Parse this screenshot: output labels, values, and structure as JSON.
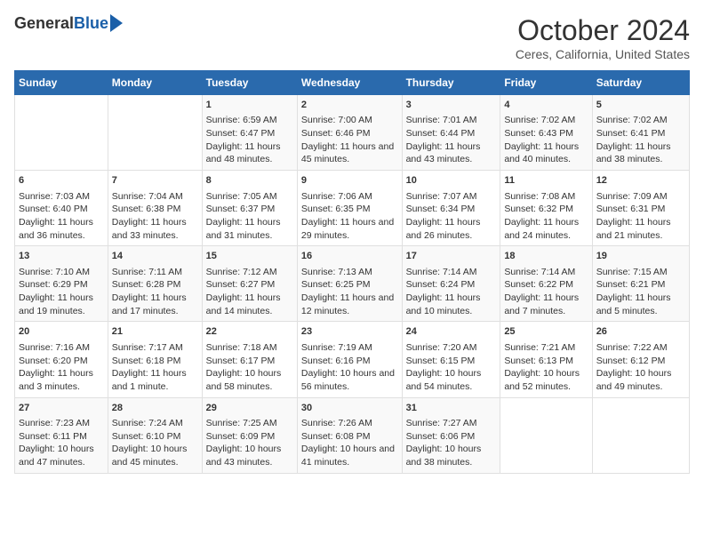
{
  "header": {
    "logo_general": "General",
    "logo_blue": "Blue",
    "month_title": "October 2024",
    "location": "Ceres, California, United States"
  },
  "columns": [
    "Sunday",
    "Monday",
    "Tuesday",
    "Wednesday",
    "Thursday",
    "Friday",
    "Saturday"
  ],
  "weeks": [
    [
      {
        "day": "",
        "sunrise": "",
        "sunset": "",
        "daylight": ""
      },
      {
        "day": "",
        "sunrise": "",
        "sunset": "",
        "daylight": ""
      },
      {
        "day": "1",
        "sunrise": "Sunrise: 6:59 AM",
        "sunset": "Sunset: 6:47 PM",
        "daylight": "Daylight: 11 hours and 48 minutes."
      },
      {
        "day": "2",
        "sunrise": "Sunrise: 7:00 AM",
        "sunset": "Sunset: 6:46 PM",
        "daylight": "Daylight: 11 hours and 45 minutes."
      },
      {
        "day": "3",
        "sunrise": "Sunrise: 7:01 AM",
        "sunset": "Sunset: 6:44 PM",
        "daylight": "Daylight: 11 hours and 43 minutes."
      },
      {
        "day": "4",
        "sunrise": "Sunrise: 7:02 AM",
        "sunset": "Sunset: 6:43 PM",
        "daylight": "Daylight: 11 hours and 40 minutes."
      },
      {
        "day": "5",
        "sunrise": "Sunrise: 7:02 AM",
        "sunset": "Sunset: 6:41 PM",
        "daylight": "Daylight: 11 hours and 38 minutes."
      }
    ],
    [
      {
        "day": "6",
        "sunrise": "Sunrise: 7:03 AM",
        "sunset": "Sunset: 6:40 PM",
        "daylight": "Daylight: 11 hours and 36 minutes."
      },
      {
        "day": "7",
        "sunrise": "Sunrise: 7:04 AM",
        "sunset": "Sunset: 6:38 PM",
        "daylight": "Daylight: 11 hours and 33 minutes."
      },
      {
        "day": "8",
        "sunrise": "Sunrise: 7:05 AM",
        "sunset": "Sunset: 6:37 PM",
        "daylight": "Daylight: 11 hours and 31 minutes."
      },
      {
        "day": "9",
        "sunrise": "Sunrise: 7:06 AM",
        "sunset": "Sunset: 6:35 PM",
        "daylight": "Daylight: 11 hours and 29 minutes."
      },
      {
        "day": "10",
        "sunrise": "Sunrise: 7:07 AM",
        "sunset": "Sunset: 6:34 PM",
        "daylight": "Daylight: 11 hours and 26 minutes."
      },
      {
        "day": "11",
        "sunrise": "Sunrise: 7:08 AM",
        "sunset": "Sunset: 6:32 PM",
        "daylight": "Daylight: 11 hours and 24 minutes."
      },
      {
        "day": "12",
        "sunrise": "Sunrise: 7:09 AM",
        "sunset": "Sunset: 6:31 PM",
        "daylight": "Daylight: 11 hours and 21 minutes."
      }
    ],
    [
      {
        "day": "13",
        "sunrise": "Sunrise: 7:10 AM",
        "sunset": "Sunset: 6:29 PM",
        "daylight": "Daylight: 11 hours and 19 minutes."
      },
      {
        "day": "14",
        "sunrise": "Sunrise: 7:11 AM",
        "sunset": "Sunset: 6:28 PM",
        "daylight": "Daylight: 11 hours and 17 minutes."
      },
      {
        "day": "15",
        "sunrise": "Sunrise: 7:12 AM",
        "sunset": "Sunset: 6:27 PM",
        "daylight": "Daylight: 11 hours and 14 minutes."
      },
      {
        "day": "16",
        "sunrise": "Sunrise: 7:13 AM",
        "sunset": "Sunset: 6:25 PM",
        "daylight": "Daylight: 11 hours and 12 minutes."
      },
      {
        "day": "17",
        "sunrise": "Sunrise: 7:14 AM",
        "sunset": "Sunset: 6:24 PM",
        "daylight": "Daylight: 11 hours and 10 minutes."
      },
      {
        "day": "18",
        "sunrise": "Sunrise: 7:14 AM",
        "sunset": "Sunset: 6:22 PM",
        "daylight": "Daylight: 11 hours and 7 minutes."
      },
      {
        "day": "19",
        "sunrise": "Sunrise: 7:15 AM",
        "sunset": "Sunset: 6:21 PM",
        "daylight": "Daylight: 11 hours and 5 minutes."
      }
    ],
    [
      {
        "day": "20",
        "sunrise": "Sunrise: 7:16 AM",
        "sunset": "Sunset: 6:20 PM",
        "daylight": "Daylight: 11 hours and 3 minutes."
      },
      {
        "day": "21",
        "sunrise": "Sunrise: 7:17 AM",
        "sunset": "Sunset: 6:18 PM",
        "daylight": "Daylight: 11 hours and 1 minute."
      },
      {
        "day": "22",
        "sunrise": "Sunrise: 7:18 AM",
        "sunset": "Sunset: 6:17 PM",
        "daylight": "Daylight: 10 hours and 58 minutes."
      },
      {
        "day": "23",
        "sunrise": "Sunrise: 7:19 AM",
        "sunset": "Sunset: 6:16 PM",
        "daylight": "Daylight: 10 hours and 56 minutes."
      },
      {
        "day": "24",
        "sunrise": "Sunrise: 7:20 AM",
        "sunset": "Sunset: 6:15 PM",
        "daylight": "Daylight: 10 hours and 54 minutes."
      },
      {
        "day": "25",
        "sunrise": "Sunrise: 7:21 AM",
        "sunset": "Sunset: 6:13 PM",
        "daylight": "Daylight: 10 hours and 52 minutes."
      },
      {
        "day": "26",
        "sunrise": "Sunrise: 7:22 AM",
        "sunset": "Sunset: 6:12 PM",
        "daylight": "Daylight: 10 hours and 49 minutes."
      }
    ],
    [
      {
        "day": "27",
        "sunrise": "Sunrise: 7:23 AM",
        "sunset": "Sunset: 6:11 PM",
        "daylight": "Daylight: 10 hours and 47 minutes."
      },
      {
        "day": "28",
        "sunrise": "Sunrise: 7:24 AM",
        "sunset": "Sunset: 6:10 PM",
        "daylight": "Daylight: 10 hours and 45 minutes."
      },
      {
        "day": "29",
        "sunrise": "Sunrise: 7:25 AM",
        "sunset": "Sunset: 6:09 PM",
        "daylight": "Daylight: 10 hours and 43 minutes."
      },
      {
        "day": "30",
        "sunrise": "Sunrise: 7:26 AM",
        "sunset": "Sunset: 6:08 PM",
        "daylight": "Daylight: 10 hours and 41 minutes."
      },
      {
        "day": "31",
        "sunrise": "Sunrise: 7:27 AM",
        "sunset": "Sunset: 6:06 PM",
        "daylight": "Daylight: 10 hours and 38 minutes."
      },
      {
        "day": "",
        "sunrise": "",
        "sunset": "",
        "daylight": ""
      },
      {
        "day": "",
        "sunrise": "",
        "sunset": "",
        "daylight": ""
      }
    ]
  ]
}
